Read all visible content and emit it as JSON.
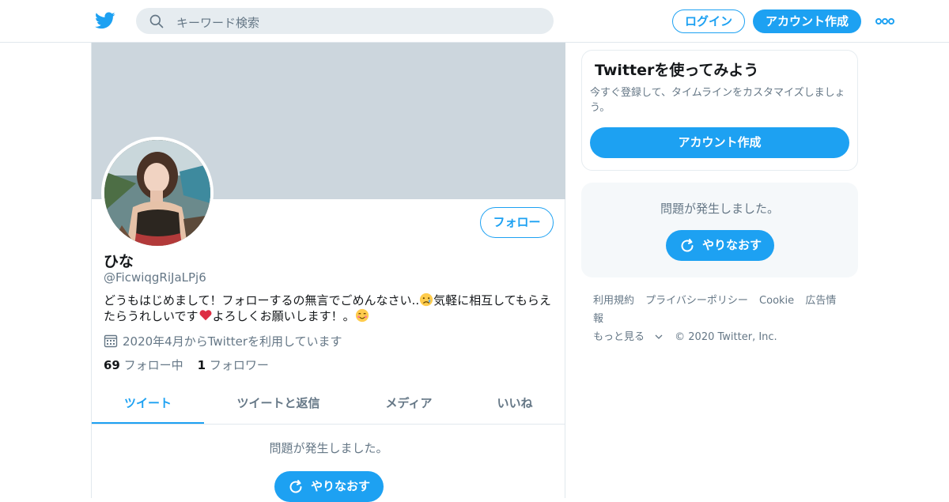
{
  "header": {
    "search_placeholder": "キーワード検索",
    "login_label": "ログイン",
    "signup_label": "アカウント作成",
    "more_icon": "more-icon"
  },
  "profile": {
    "name": "ひな",
    "handle": "@FicwiqgRiJaLPj6",
    "bio_part1": "どうもはじめまして！フォローするの無言でごめんなさい..",
    "bio_part2": "気軽に相互してもらえたらうれしいです",
    "bio_part3": "よろしくお願いします！。",
    "joined": "2020年4月からTwitterを利用しています",
    "following_count": "69",
    "following_label": "フォロー中",
    "followers_count": "1",
    "followers_label": "フォロワー",
    "follow_button": "フォロー"
  },
  "tabs": [
    {
      "label": "ツイート",
      "active": true
    },
    {
      "label": "ツイートと返信",
      "active": false
    },
    {
      "label": "メディア",
      "active": false
    },
    {
      "label": "いいね",
      "active": false
    }
  ],
  "main_error": {
    "message": "問題が発生しました。",
    "retry_label": "やりなおす"
  },
  "sidebar": {
    "signup_card": {
      "title": "Twitterを使ってみよう",
      "description": "今すぐ登録して、タイムラインをカスタマイズしましょう。",
      "button": "アカウント作成"
    },
    "error_card": {
      "message": "問題が発生しました。",
      "retry_label": "やりなおす"
    },
    "footer": {
      "links": [
        "利用規約",
        "プライバシーポリシー",
        "Cookie",
        "広告情報"
      ],
      "more": "もっと見る",
      "copyright": "© 2020 Twitter, Inc."
    }
  },
  "colors": {
    "accent": "#1da1f2",
    "banner": "#ccd6dd",
    "secondary_text": "#657786"
  }
}
